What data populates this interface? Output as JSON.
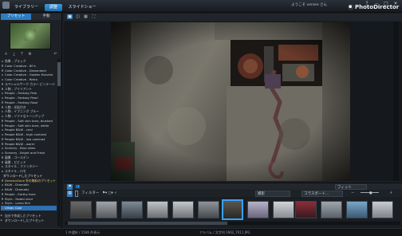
{
  "header": {
    "tabs": [
      {
        "label": "ライブラリー"
      },
      {
        "label": "調整"
      },
      {
        "label": "スライドショー"
      }
    ],
    "active_tab": 1,
    "user": "ようこそ versee さん",
    "window_buttons": [
      "?",
      "‒",
      "□",
      "✕"
    ],
    "brand": "PhotoDirector"
  },
  "left_panel": {
    "subtabs": [
      "プリセット",
      "手動"
    ],
    "active_subtab": 0,
    "presets": [
      {
        "label": "効果 - ブラック",
        "type": "item"
      },
      {
        "label": "Color Creative - 80's",
        "type": "item"
      },
      {
        "label": "Color Creative - Dreamland",
        "type": "item"
      },
      {
        "label": "Color Creative - Golden Harvest",
        "type": "item"
      },
      {
        "label": "Color Creative - Retro",
        "type": "item"
      },
      {
        "label": "スペシャルサーク カラー ビンテージ",
        "type": "item"
      },
      {
        "label": "人物 - ブリリアント",
        "type": "item"
      },
      {
        "label": "People - Fantasy Pale",
        "type": "item"
      },
      {
        "label": "People - Fantasy Pearl",
        "type": "item"
      },
      {
        "label": "People - Fantasy Rose",
        "type": "item"
      },
      {
        "label": "人物 - 光彩付き",
        "type": "item"
      },
      {
        "label": "人物 - イブニング ブルー",
        "type": "item"
      },
      {
        "label": "人物 - ソフトなトーンアップ",
        "type": "item"
      },
      {
        "label": "People - Soft skin tone, blushed",
        "type": "item"
      },
      {
        "label": "People - Soft skin tone, white",
        "type": "item"
      },
      {
        "label": "People B&W - cool",
        "type": "item"
      },
      {
        "label": "People B&W - high contrast",
        "type": "item"
      },
      {
        "label": "People B&W - low contrast",
        "type": "item"
      },
      {
        "label": "People B&W - warm",
        "type": "item"
      },
      {
        "label": "Scenery - Blue skies",
        "type": "item"
      },
      {
        "label": "Scenery - Bright and Fresh",
        "type": "item"
      },
      {
        "label": "風景 - ゴールデン",
        "type": "item"
      },
      {
        "label": "風景 - ビビッド",
        "type": "item"
      },
      {
        "label": "スタイル - ファンタジー",
        "type": "item"
      },
      {
        "label": "スタイル - ロモ",
        "type": "item"
      },
      {
        "label": "ダウンロードしたプリセット",
        "type": "hdr"
      },
      {
        "label": "DirectorZone 外の無料のプリセット",
        "type": "hi"
      },
      {
        "label": "B&W - Dramatic",
        "type": "item"
      },
      {
        "label": "B&W - Dramatic",
        "type": "item"
      },
      {
        "label": "People - Earthy tone",
        "type": "item"
      },
      {
        "label": "Style - Faded vivid",
        "type": "item"
      },
      {
        "label": "Style - Lomo film",
        "type": "item"
      },
      {
        "label": "Urban Cool",
        "type": "sel"
      }
    ],
    "bottom_groups": [
      "自分で作成したプリセット",
      "ダウンロードしたプリセット"
    ]
  },
  "bottom_toolbar": {
    "filter_label": "フィルター",
    "sort_value": "撮影",
    "collection_value": "コラスポート...",
    "fit_value": "フィット"
  },
  "status_bar": {
    "left": "1 件選択 / 1546 件表示",
    "right": "アルバム / 文字列 1962_7011 JPG"
  }
}
